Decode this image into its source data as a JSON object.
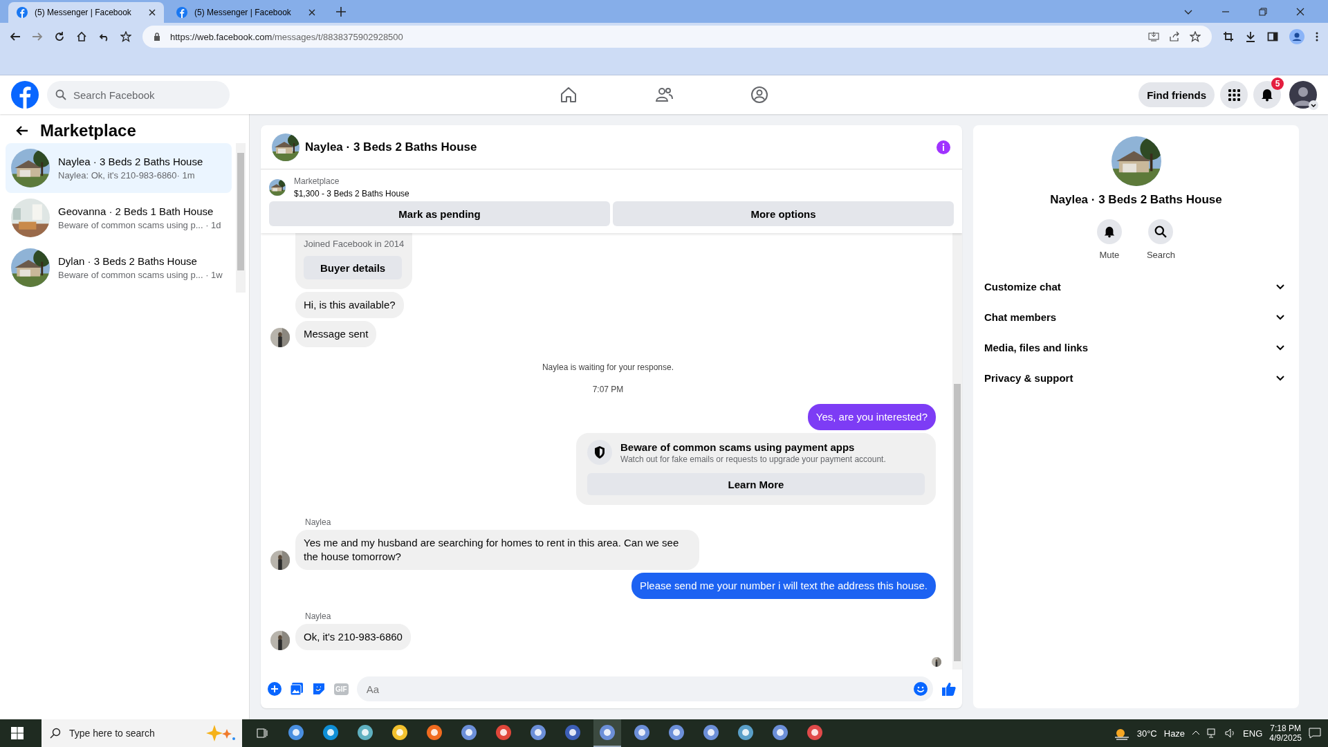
{
  "browser": {
    "tabs": [
      {
        "title": "(5) Messenger | Facebook",
        "selected": true
      },
      {
        "title": "(5) Messenger | Facebook",
        "selected": false
      }
    ],
    "url_host": "https://web.facebook.com",
    "url_path": "/messages/t/8838375902928500"
  },
  "header": {
    "search_placeholder": "Search Facebook",
    "nav": [
      {
        "kind": "home",
        "selected": false
      },
      {
        "kind": "friends",
        "selected": false
      },
      {
        "kind": "groups",
        "selected": false
      }
    ],
    "find_friends": "Find friends",
    "notification_count": "5"
  },
  "sidebar": {
    "title": "Marketplace",
    "chats": [
      {
        "name": "Naylea · 3 Beds 2 Baths House",
        "preview": "Naylea: Ok, it's 210-983-6860",
        "time": "· 1m",
        "selected": true
      },
      {
        "name": "Geovanna · 2 Beds 1 Bath House",
        "preview": "Beware of common scams using p...",
        "time": " · 1d",
        "selected": false
      },
      {
        "name": "Dylan · 3 Beds 2 Baths House",
        "preview": "Beware of common scams using p...",
        "time": " · 1w",
        "selected": false
      }
    ]
  },
  "chat": {
    "title": "Naylea · 3 Beds 2 Baths House",
    "listing": {
      "label": "Marketplace",
      "text": "$1,300 - 3 Beds 2 Baths House"
    },
    "actions": [
      "Mark as pending",
      "More options"
    ],
    "messages": [
      {
        "kind": "profile",
        "text": "Joined Facebook in 2014",
        "button": "Buyer details"
      },
      {
        "kind": "in",
        "text": "Hi, is this available?",
        "avatar": false
      },
      {
        "kind": "in",
        "text": "Message sent",
        "avatar": true
      },
      {
        "kind": "notice",
        "text": "Naylea is waiting for your response."
      },
      {
        "kind": "time",
        "text": "7:07 PM"
      },
      {
        "kind": "out",
        "text": "Yes, are you interested?",
        "color": "#7d3cf5"
      },
      {
        "kind": "alert",
        "title": "Beware of common scams using payment apps",
        "text": "Watch out for fake emails or requests to upgrade your payment account.",
        "button": "Learn More"
      },
      {
        "kind": "in",
        "sender": "Naylea",
        "text": "Yes me and my husband are searching for homes to rent in this area. Can we see the house tomorrow?",
        "avatar": true
      },
      {
        "kind": "out",
        "text": "Please send me your number i will text the address this house.",
        "color": "#1c62f2"
      },
      {
        "kind": "in",
        "sender": "Naylea",
        "text": "Ok, it's 210-983-6860",
        "avatar": true
      }
    ],
    "composer": {
      "gif_label": "GIF",
      "placeholder": "Aa"
    }
  },
  "details": {
    "title": "Naylea · 3 Beds 2 Baths House",
    "actions": [
      {
        "kind": "bell",
        "label": "Mute"
      },
      {
        "kind": "search",
        "label": "Search"
      }
    ],
    "sections": [
      {
        "label": "Customize chat",
        "expanded": false
      },
      {
        "label": "Chat members",
        "expanded": false
      },
      {
        "label": "Media, files and links",
        "expanded": false
      },
      {
        "label": "Privacy & support",
        "expanded": false
      }
    ]
  },
  "taskbar": {
    "search_placeholder": "Type here to search",
    "temperature": "30°C",
    "weather": "Haze",
    "language": "ENG",
    "time": "7:18 PM",
    "date": "4/9/2025"
  }
}
